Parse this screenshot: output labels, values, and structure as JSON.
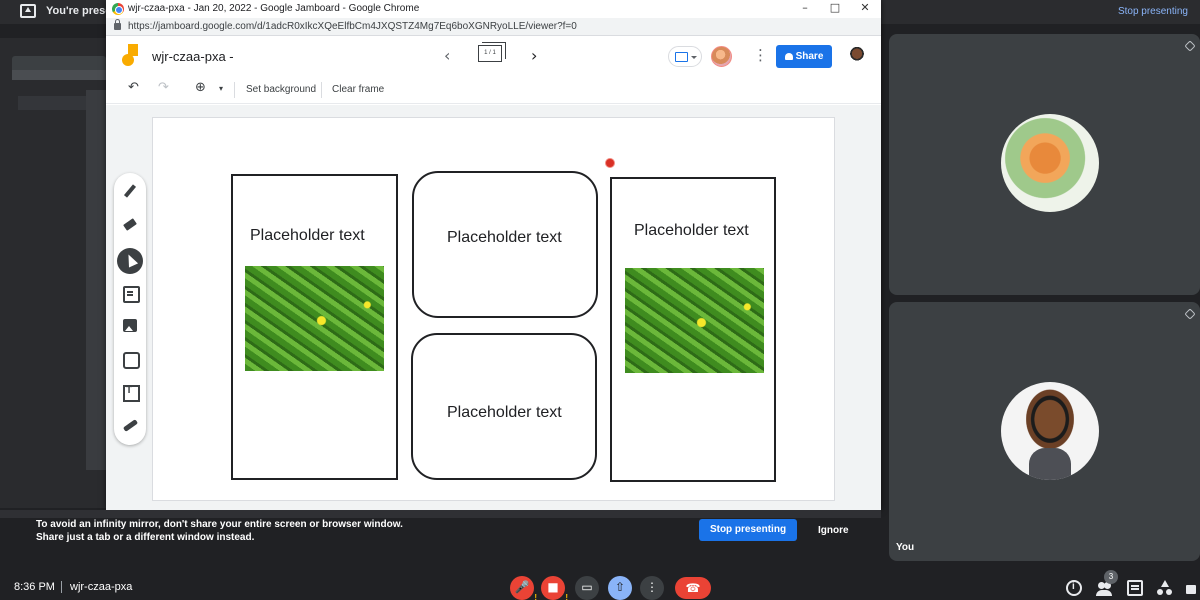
{
  "meet": {
    "present_banner_text": "You're presenting",
    "stop_presenting_top": "Stop presenting",
    "time": "8:36 PM",
    "meeting_code": "wjr-czaa-pxa",
    "people_count": "3",
    "you_label": "You",
    "mirror_warning": "To avoid an infinity mirror, don't share your entire screen or browser window. Share just a tab or a different window instead.",
    "stop_presenting_button": "Stop presenting",
    "ignore_button": "Ignore",
    "colors": {
      "accent": "#1a73e8",
      "danger": "#ea4335",
      "background": "#202124",
      "tile": "#3c4043"
    }
  },
  "browser": {
    "window_title": "wjr-czaa-pxa - Jan 20, 2022 - Google Jamboard - Google Chrome",
    "url": "https://jamboard.google.com/d/1adcR0xIkcXQeElfbCm4JXQSTZ4Mg7Eq6boXGNRyoLLE/viewer?f=0",
    "minimize": "–",
    "maximize": "□",
    "close": "✕"
  },
  "jamboard": {
    "doc_title": "wjr-czaa-pxa -",
    "frame_counter": "1 / 1",
    "prev_glyph": "‹",
    "next_glyph": "›",
    "kebab_glyph": "⋮",
    "share_label": "Share",
    "toolbar": {
      "undo_glyph": "↶",
      "redo_glyph": "↷",
      "zoom_glyph": "⊕",
      "zoom_caret": "▾",
      "set_background": "Set background",
      "clear_frame": "Clear frame"
    },
    "cards": [
      {
        "text": "Placeholder text",
        "has_image": true
      },
      {
        "text": "Placeholder text",
        "has_image": false
      },
      {
        "text": "Placeholder text",
        "has_image": false
      },
      {
        "text": "Placeholder text",
        "has_image": true
      }
    ],
    "side_tools": [
      "pen-icon",
      "eraser-icon",
      "select-icon",
      "sticky-note-icon",
      "image-icon",
      "shape-icon",
      "text-box-icon",
      "laser-icon"
    ]
  },
  "controls": {
    "mic_glyph": "🎤",
    "cam_glyph": "■",
    "captions_glyph": "▭",
    "present_glyph": "⇧",
    "more_glyph": "⋮",
    "end_glyph": "☎",
    "warning_glyph": "!"
  }
}
